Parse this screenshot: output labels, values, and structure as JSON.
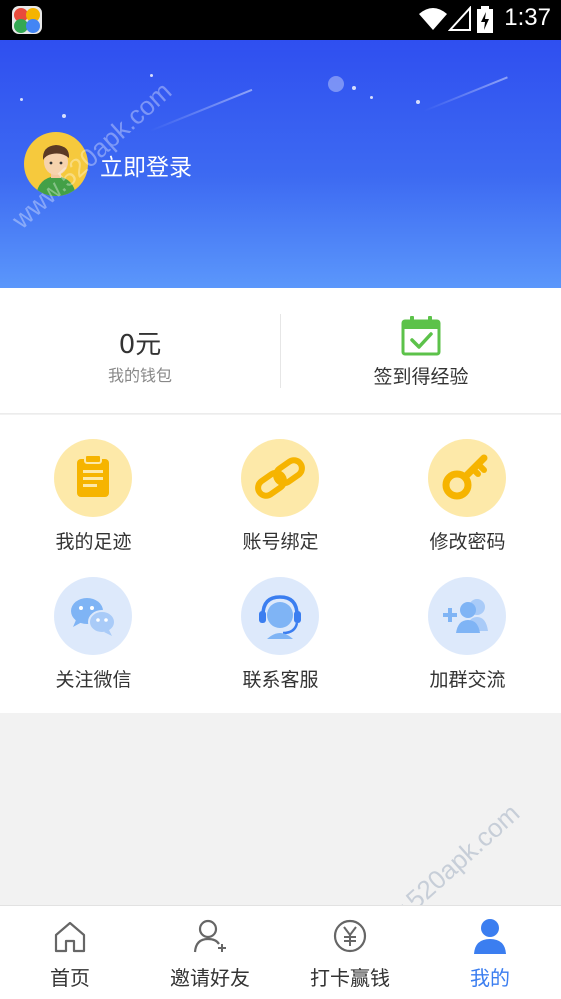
{
  "status_bar": {
    "time": "1:37",
    "icons": [
      "app-icon",
      "wifi-icon",
      "signal-icon",
      "battery-charging-icon"
    ]
  },
  "header": {
    "login_text": "立即登录",
    "watermark": "www.520apk.com"
  },
  "wallet": {
    "balance": "0元",
    "balance_label": "我的钱包",
    "checkin_label": "签到得经验"
  },
  "grid": {
    "items": [
      {
        "label": "我的足迹",
        "icon": "clipboard-icon"
      },
      {
        "label": "账号绑定",
        "icon": "link-icon"
      },
      {
        "label": "修改密码",
        "icon": "key-icon"
      },
      {
        "label": "关注微信",
        "icon": "wechat-icon"
      },
      {
        "label": "联系客服",
        "icon": "headset-icon"
      },
      {
        "label": "加群交流",
        "icon": "add-group-icon"
      }
    ]
  },
  "bottom_nav": {
    "items": [
      {
        "label": "首页",
        "icon": "home-icon"
      },
      {
        "label": "邀请好友",
        "icon": "invite-user-icon"
      },
      {
        "label": "打卡赢钱",
        "icon": "yen-coin-icon"
      },
      {
        "label": "我的",
        "icon": "profile-icon"
      }
    ],
    "active": "我的"
  },
  "colors": {
    "header_top": "#2f4ff0",
    "header_bottom": "#5b97fb",
    "accent": "#3b7ef0",
    "checkin_green": "#5cc24a",
    "yellow_circle": "#fde9a9",
    "blue_circle": "#dde9fb"
  }
}
